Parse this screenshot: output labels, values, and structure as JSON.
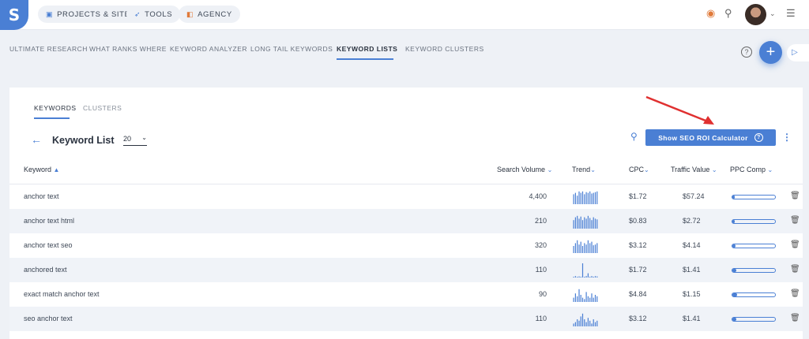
{
  "nav": {
    "logo": "S",
    "pills": [
      {
        "label": "PROJECTS & SITES",
        "icon": "briefcase-icon"
      },
      {
        "label": "TOOLS",
        "icon": "rocket-icon"
      },
      {
        "label": "AGENCY",
        "icon": "bag-icon"
      }
    ]
  },
  "subnav": {
    "items": [
      "ULTIMATE RESEARCH",
      "WHAT RANKS WHERE",
      "KEYWORD ANALYZER",
      "LONG TAIL KEYWORDS",
      "KEYWORD LISTS",
      "KEYWORD CLUSTERS"
    ],
    "active": "KEYWORD LISTS"
  },
  "tabs": [
    "KEYWORDS",
    "CLUSTERS"
  ],
  "list": {
    "title": "Keyword List",
    "count": "20",
    "roi_button": "Show SEO ROI Calculator"
  },
  "columns": {
    "keyword": "Keyword",
    "search_volume": "Search Volume",
    "trend": "Trend",
    "cpc": "CPC",
    "traffic_value": "Traffic Value",
    "ppc_comp": "PPC Comp"
  },
  "rows": [
    {
      "keyword": "anchor text",
      "search_volume": "4,400",
      "cpc": "$1.72",
      "traffic_value": "$57.24",
      "ppc_comp": 0.06,
      "trend": [
        0.7,
        0.8,
        0.6,
        0.9,
        0.8,
        0.9,
        0.7,
        0.85,
        0.8,
        0.9,
        0.75,
        0.8,
        0.85,
        0.9
      ]
    },
    {
      "keyword": "anchor text html",
      "search_volume": "210",
      "cpc": "$0.83",
      "traffic_value": "$2.72",
      "ppc_comp": 0.05,
      "trend": [
        0.6,
        0.8,
        0.9,
        0.7,
        0.85,
        0.6,
        0.8,
        0.7,
        0.9,
        0.75,
        0.6,
        0.8,
        0.7,
        0.65
      ]
    },
    {
      "keyword": "anchor text seo",
      "search_volume": "320",
      "cpc": "$3.12",
      "traffic_value": "$4.14",
      "ppc_comp": 0.08,
      "trend": [
        0.5,
        0.7,
        0.9,
        0.6,
        0.8,
        0.5,
        0.7,
        0.6,
        0.9,
        0.7,
        0.8,
        0.55,
        0.6,
        0.7
      ]
    },
    {
      "keyword": "anchored text",
      "search_volume": "110",
      "cpc": "$1.72",
      "traffic_value": "$1.41",
      "ppc_comp": 0.1,
      "trend": [
        0.05,
        0.1,
        0.05,
        0.08,
        0.05,
        1.0,
        0.05,
        0.1,
        0.3,
        0.05,
        0.1,
        0.05,
        0.1,
        0.08
      ]
    },
    {
      "keyword": "exact match anchor text",
      "search_volume": "90",
      "cpc": "$4.84",
      "traffic_value": "$1.15",
      "ppc_comp": 0.12,
      "trend": [
        0.3,
        0.6,
        0.4,
        0.9,
        0.5,
        0.3,
        0.2,
        0.7,
        0.4,
        0.3,
        0.6,
        0.3,
        0.5,
        0.4
      ]
    },
    {
      "keyword": "seo anchor text",
      "search_volume": "110",
      "cpc": "$3.12",
      "traffic_value": "$1.41",
      "ppc_comp": 0.09,
      "trend": [
        0.2,
        0.3,
        0.5,
        0.4,
        0.7,
        0.9,
        0.5,
        0.3,
        0.6,
        0.4,
        0.2,
        0.5,
        0.3,
        0.4
      ]
    }
  ],
  "colors": {
    "accent": "#4a7fd4",
    "arrow": "#e03030"
  }
}
